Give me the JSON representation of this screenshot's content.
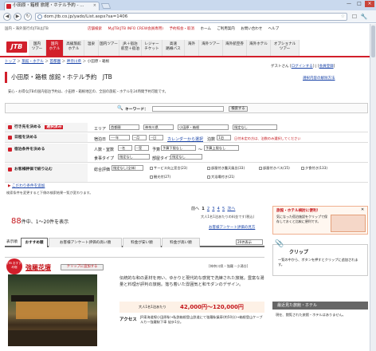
{
  "browser": {
    "tab_title": "小田原・箱根 旅館・ホテル予約 - ...",
    "tab_close": "×",
    "url": "dom.jtb.co.jp/yado/List.aspx?sa=1406",
    "controls": [
      "—",
      "□",
      "×"
    ],
    "nav": [
      "◀",
      "▶",
      "↻"
    ],
    "tools": [
      "☐",
      "🔧"
    ]
  },
  "header": {
    "tagline": "国内・海外旅行のJTBはJTB",
    "links": [
      "店舗検索",
      "MyJTB(JTB INFO CREW会員専用)",
      "予約照会・取消",
      "ホーム",
      "ご利用案内",
      "お問い合わせ",
      "ヘルプ"
    ],
    "logo": "JTB"
  },
  "gnav": [
    {
      "label": "国内\nツアー",
      "style": "grey"
    },
    {
      "label": "国内\nホテル",
      "style": "active"
    },
    {
      "label": "高級旅館\nホテル",
      "style": "grey"
    },
    {
      "label": "温泉",
      "style": "grey"
    },
    {
      "label": "国内ツアー",
      "style": "grey"
    },
    {
      "label": "JR＋宿泊\n航空＋宿泊",
      "style": "grey"
    },
    {
      "label": "レジャー\nチケット",
      "style": "grey"
    },
    {
      "label": "高速\n路線バス",
      "style": "grey"
    },
    {
      "label": "海外",
      "style": "grey"
    },
    {
      "label": "海外ツアー",
      "style": "grey"
    },
    {
      "label": "海外航空券",
      "style": "grey"
    },
    {
      "label": "海外ホテル",
      "style": "grey"
    },
    {
      "label": "オプショナル\nツアー",
      "style": "grey"
    }
  ],
  "breadcrumb": [
    "トップ",
    "旅館・ホテル",
    "首都圏",
    "神奈川県",
    "小田原・箱根"
  ],
  "guest": "ゲストさん",
  "login": "ログインする",
  "member": "会員登録",
  "title": "小田原・箱根 旅館・ホテル予約　JTB",
  "help_link": "選択内容の解除方法",
  "description": "安心・お得なJTBの国内宿泊予約は、小田原・箱根地区の、全国の旅館・ホテルを24時間予約可能です。",
  "keyword": {
    "label": "キーワード：",
    "button": "検索する"
  },
  "rows": [
    {
      "label": "行き先を決める",
      "badge": "選択済み",
      "fields": [
        "エリア",
        "首都圏",
        "神奈川県",
        "小田原・箱根",
        "指定なし"
      ]
    },
    {
      "label": "日程を決める",
      "fields": [
        "宿泊日",
        "----年",
        "--月",
        "--日",
        "カレンダーから選択",
        "泊数",
        "1泊"
      ],
      "note": "日付未定の方は、泊数のみ選択してください"
    },
    {
      "label": "宿泊条件を決める",
      "fields": [
        "人数・室数",
        "--名",
        "--室",
        "予算",
        "予算下限なし",
        "～",
        "予算上限なし"
      ],
      "fields2": [
        "食事タイプ",
        "指定なし",
        "部屋タイプ",
        "指定なし"
      ]
    },
    {
      "label": "お客様評価で絞り込む",
      "fields": [
        "総合評価",
        "指定なし(全体)"
      ],
      "checks": [
        "サービス向上宣言(23)",
        "部屋付き露天風呂(33)",
        "部屋付きバス(15)",
        "夕食付き(133)",
        "観光付(27)",
        "大浴場付き(21)"
      ]
    }
  ],
  "detail_link": "こだわり条件を追加",
  "footnote": "検索条件を変更すると下側の検索結果一覧が変わります。",
  "pager": {
    "prev": "前へ",
    "pages": [
      "1",
      "2",
      "3",
      "4",
      "5"
    ],
    "next": "次へ"
  },
  "price_note": "大人1名1泊あたりの料金です(税込)",
  "count": {
    "number": "88",
    "text": "件中、1～20件を表示"
  },
  "enquete": "お客様アンケート評価の見方",
  "sort": {
    "label": "表示順",
    "tabs": [
      "おすすめ順",
      "お客様アンケート評価の高い順",
      "料金が安い順",
      "料金が高い順"
    ],
    "per_page": "20件表示"
  },
  "hotel": {
    "badge": "JTB おすすめ宿",
    "name": "強羅花壇",
    "clip": "クリップに追加する",
    "area": "[神奈川県・強羅・小涌谷]",
    "desc": "伝統的な和の素材を用い、ゆかりと現代的な感覚で洗練された旅館。豊富な湯量と料理が評判の旅館。落ち着いた雰囲気と和モダンのデザイン。",
    "price_label": "大人1名1泊あたり",
    "price": "42,000円～120,000円",
    "access_label": "アクセス",
    "access": "JR東海道線小田原駅→私鉄箱根登山鉄道にて強羅駅乗車(約50分)→箱根登山ケーブルカー強羅駅下車 徒歩1分。"
  },
  "sidebar": {
    "clip_title": "旅館・ホテル検討に便利！",
    "clip_text": "気になった宿泊施設をクリップで保存しておくと比較に便利です。",
    "clip_btn": "✕",
    "clip_header": "クリップ",
    "clip_desc": "一覧の中から、ボタンを押すとクリップに追加されます。",
    "recent_header": "最近見た旅館・ホテル",
    "recent_text": "現在、閲覧された旅館・ホテルはありません。"
  }
}
